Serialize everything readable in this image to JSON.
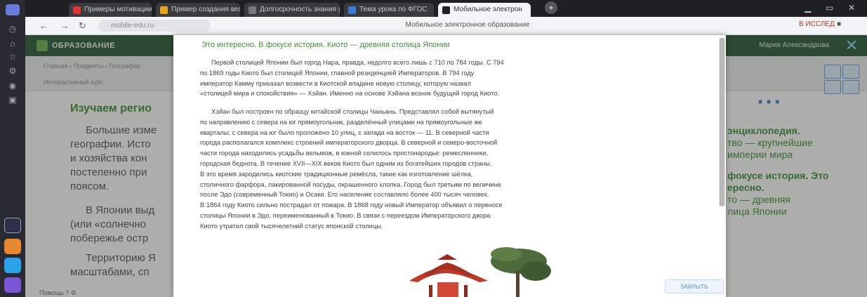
{
  "browser": {
    "tabs": [
      {
        "label": "Примеры мотивации уче",
        "fav": "#d33"
      },
      {
        "label": "Пример создания велос",
        "fav": "#e8a317"
      },
      {
        "label": "Долгосрочность знания у",
        "fav": "#555"
      },
      {
        "label": "Тема урока по ФГОС",
        "fav": "#3a7bd5"
      },
      {
        "label": "Мобильное электрон",
        "fav": "#222"
      }
    ],
    "new_tab": "+",
    "url": "mobile-edu.ru",
    "page_name": "Мобильное электронное образование",
    "ext_label": "В ИССЛЕД",
    "ext_label2": "■"
  },
  "site": {
    "brand": "ОБРАЗОВАНИЕ",
    "user": "Мария Александрова",
    "close_icon": "✕",
    "breadcrumb": "Главная › Предметы › География",
    "breadcrumb2": "Интерактивный курс",
    "section_title": "Изучаем регио",
    "paragraph_lines": [
      "Большие изме",
      "географии. Исто",
      "и хозяйства кон",
      "постепенно при",
      "поясом.",
      "В Японии выд",
      "(или «солнечно",
      "побережье остр",
      "Территорию Я",
      "масштабами, сп"
    ],
    "right_panel": [
      "энциклопедия.",
      "тво — крупнейшие",
      "империи мира",
      "фокусе история. Это",
      "ересно.",
      "то — древняя",
      "лица Японии"
    ],
    "footer": "Помощь ? ⚙"
  },
  "modal": {
    "title": "Это интересно. В фокусе история. Киото — древняя столица Японии",
    "paragraph1": [
      "Первой столицей Японии был город Нара, правда, недолго всего лишь с 710 по 784 годы. С 794",
      "по 1869 годы Киото был столицей Японии, главной резиденцией Императоров. В 794 году",
      "император Камму приказал возвести в Киотской впадине новую столицу, которую назвал",
      "«столицей мира и спокойствия» — Хэйан. Именно на основе Хэйана возник будущий город Киото."
    ],
    "paragraph2": [
      "Хэйан был построен по образцу китайской столицы Чаньань. Представлял собой вытянутый",
      "по направлению с севера на юг прямоугольник, разделённый улицами на прямоугольные же",
      "кварталы; с севера на юг было проложено 10 улиц, с запада на восток — 11. В северной части",
      "города располагался комплекс строений императорского дворца. В северной и северо-восточной",
      "части города находились усадьбы вельмож, в южной селилось простонародье: ремесленники,",
      "городская беднота. В течение XVII—XIX веков Киото был одним из богатейших городов страны.",
      "В это время зародились киотские традиционные ремёсла, такие как изготовление шёлка,",
      "столичного фарфора, лакированной посуды, окрашенного хлопка. Город был третьим по величине",
      "после Эдо (современный Токио) и Осаки. Его население составляло более 400 тысяч человек.",
      "В 1864 году Киото сильно пострадал от пожара. В 1868 году новый Император объявил о переносе",
      "столицы Японии в Эдо, переименованный в Токио. В связи с переездом Императорского двора",
      "Киото утратил свой тысячелетний статус японской столицы."
    ],
    "close_label": "ЗАКРЫТЬ"
  }
}
